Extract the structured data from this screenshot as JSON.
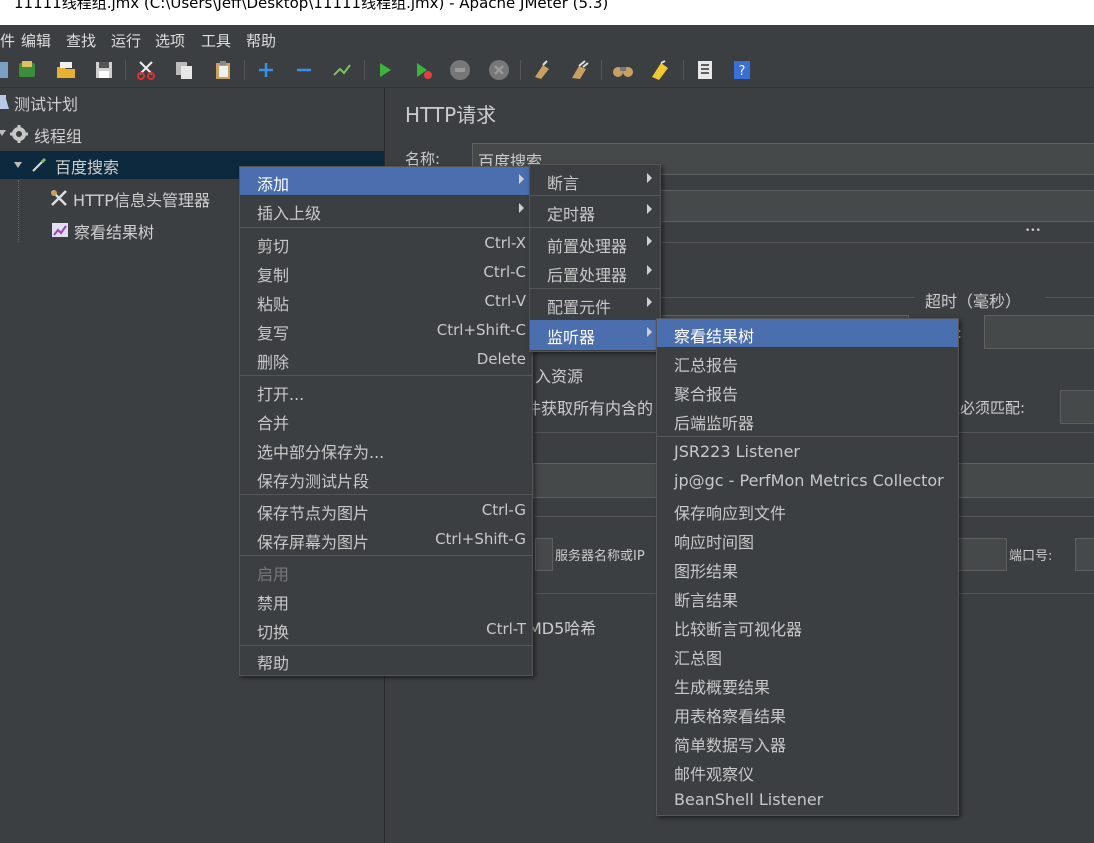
{
  "window": {
    "title": "11111线程组.jmx (C:\\Users\\Jeff\\Desktop\\11111线程组.jmx) - Apache JMeter (5.3)"
  },
  "menubar": [
    "件",
    "编辑",
    "查找",
    "运行",
    "选项",
    "工具",
    "帮助"
  ],
  "toolbar": {
    "icons": [
      "templates-icon",
      "open-icon",
      "save-icon",
      "cut-icon",
      "copy-icon",
      "paste-icon",
      "expand-icon",
      "collapse-icon",
      "toggle-icon",
      "start-icon",
      "start-no-pause-icon",
      "stop-icon",
      "shutdown-icon",
      "clear-icon",
      "clear-all-icon",
      "search-icon",
      "reset-search-icon",
      "function-helper-icon",
      "help-icon"
    ]
  },
  "tree": {
    "nodes": [
      {
        "label": "测试计划",
        "icon": "test-plan-icon"
      },
      {
        "label": "线程组",
        "icon": "gear-icon"
      },
      {
        "label": "百度搜索",
        "icon": "pipette-icon"
      },
      {
        "label": "HTTP信息头管理器",
        "icon": "wrench-icon"
      },
      {
        "label": "察看结果树",
        "icon": "chart-icon"
      }
    ]
  },
  "panel": {
    "title": "HTTP请求",
    "name_label": "名称:",
    "name_value": "百度搜索",
    "timeout_label": "超时（毫秒）",
    "colon_label": ":",
    "embedded_label": "入资源",
    "retrieve_label": "件获取所有内含的",
    "must_match_label": "上必须匹配:",
    "server_label": "服务器名称或IP",
    "port_label": "端口号:",
    "md5_label": "MD5哈希",
    "ellipsis": "•••"
  },
  "context_menu": {
    "items": [
      {
        "label": "添加",
        "shortcut": "",
        "submenu": true,
        "selected": true
      },
      {
        "label": "插入上级",
        "shortcut": "",
        "submenu": true
      },
      {
        "label": "剪切",
        "shortcut": "Ctrl-X"
      },
      {
        "label": "复制",
        "shortcut": "Ctrl-C"
      },
      {
        "label": "粘贴",
        "shortcut": "Ctrl-V"
      },
      {
        "label": "复写",
        "shortcut": "Ctrl+Shift-C"
      },
      {
        "label": "删除",
        "shortcut": "Delete"
      },
      {
        "label": "打开...",
        "shortcut": ""
      },
      {
        "label": "合并",
        "shortcut": ""
      },
      {
        "label": "选中部分保存为...",
        "shortcut": ""
      },
      {
        "label": "保存为测试片段",
        "shortcut": ""
      },
      {
        "label": "保存节点为图片",
        "shortcut": "Ctrl-G"
      },
      {
        "label": "保存屏幕为图片",
        "shortcut": "Ctrl+Shift-G"
      },
      {
        "label": "启用",
        "shortcut": "",
        "disabled": true
      },
      {
        "label": "禁用",
        "shortcut": ""
      },
      {
        "label": "切换",
        "shortcut": "Ctrl-T"
      },
      {
        "label": "帮助",
        "shortcut": ""
      }
    ]
  },
  "add_submenu": {
    "items": [
      {
        "label": "断言"
      },
      {
        "label": "定时器"
      },
      {
        "label": "前置处理器"
      },
      {
        "label": "后置处理器"
      },
      {
        "label": "配置元件"
      },
      {
        "label": "监听器",
        "selected": true
      }
    ]
  },
  "listener_submenu": {
    "items": [
      {
        "label": "察看结果树",
        "selected": true
      },
      {
        "label": "汇总报告"
      },
      {
        "label": "聚合报告"
      },
      {
        "label": "后端监听器"
      },
      {
        "label": "JSR223 Listener"
      },
      {
        "label": "jp@gc - PerfMon Metrics Collector"
      },
      {
        "label": "保存响应到文件"
      },
      {
        "label": "响应时间图"
      },
      {
        "label": "图形结果"
      },
      {
        "label": "断言结果"
      },
      {
        "label": "比较断言可视化器"
      },
      {
        "label": "汇总图"
      },
      {
        "label": "生成概要结果"
      },
      {
        "label": "用表格察看结果"
      },
      {
        "label": "简单数据写入器"
      },
      {
        "label": "邮件观察仪"
      },
      {
        "label": "BeanShell Listener"
      }
    ]
  },
  "colors": {
    "selection": "#4b6eaf",
    "background": "#3c3f41"
  }
}
